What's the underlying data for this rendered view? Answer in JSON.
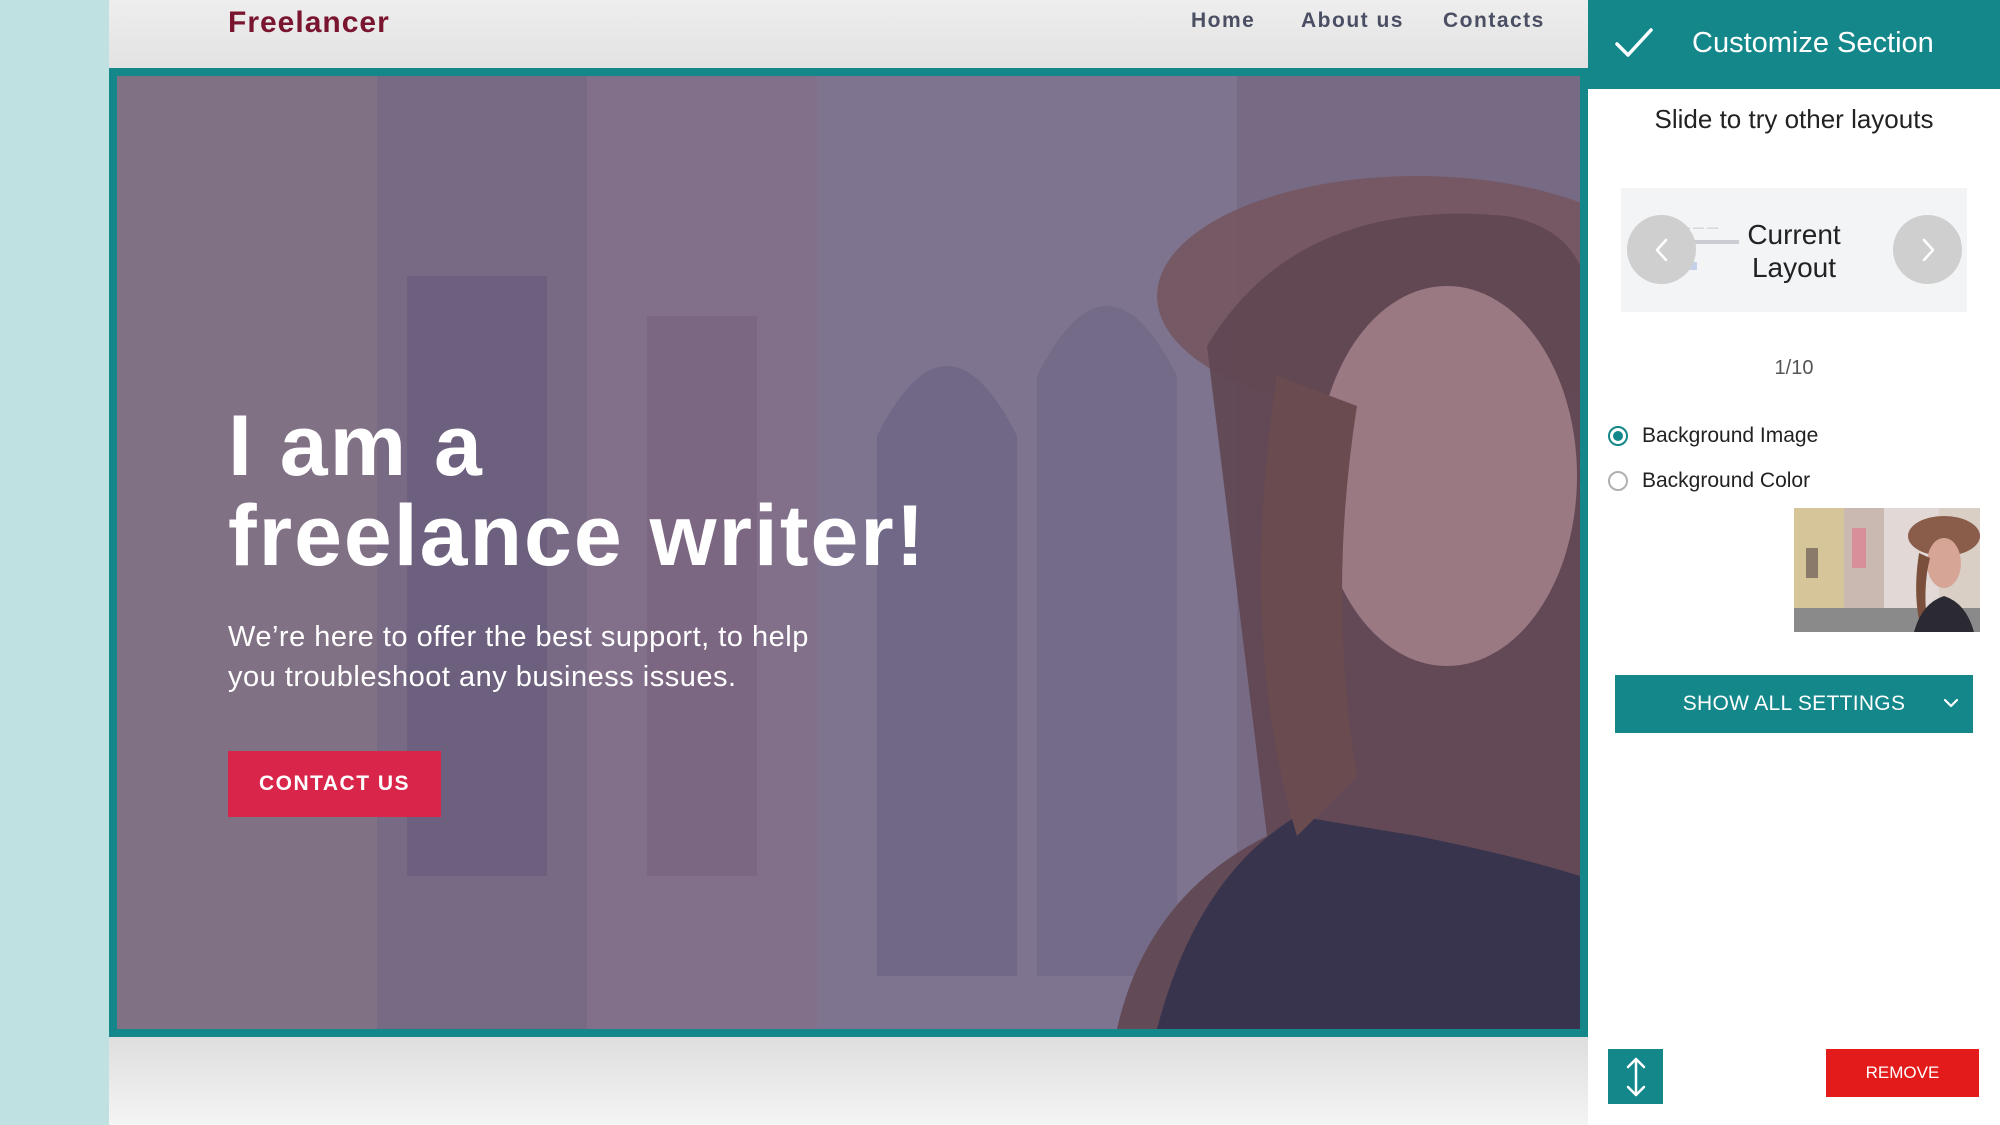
{
  "site": {
    "brand": "Freelancer",
    "nav": [
      {
        "label": "Home"
      },
      {
        "label": "About us"
      },
      {
        "label": "Contacts"
      }
    ]
  },
  "hero": {
    "title_line1": "I am a",
    "title_line2": "freelance writer!",
    "subtitle_line1": "We’re here to offer the best support, to help",
    "subtitle_line2": "you troubleshoot any business issues.",
    "cta_label": "CONTACT US"
  },
  "panel": {
    "title": "Customize Section",
    "slide_hint": "Slide to try other layouts",
    "layout_label_line1": "Current",
    "layout_label_line2": "Layout",
    "page_count": "1/10",
    "options": [
      {
        "label": "Background Image",
        "selected": true
      },
      {
        "label": "Background Color",
        "selected": false
      }
    ],
    "settings_button": "SHOW ALL SETTINGS",
    "remove_button": "REMOVE"
  },
  "colors": {
    "accent": "#13878a",
    "brand": "#7a1530",
    "cta": "#d9254a",
    "remove": "#e31b1b",
    "background": "#bfe1e2"
  },
  "icons": [
    "check-icon",
    "chevron-left-icon",
    "chevron-right-icon",
    "chevron-down-icon",
    "move-vertical-icon"
  ]
}
